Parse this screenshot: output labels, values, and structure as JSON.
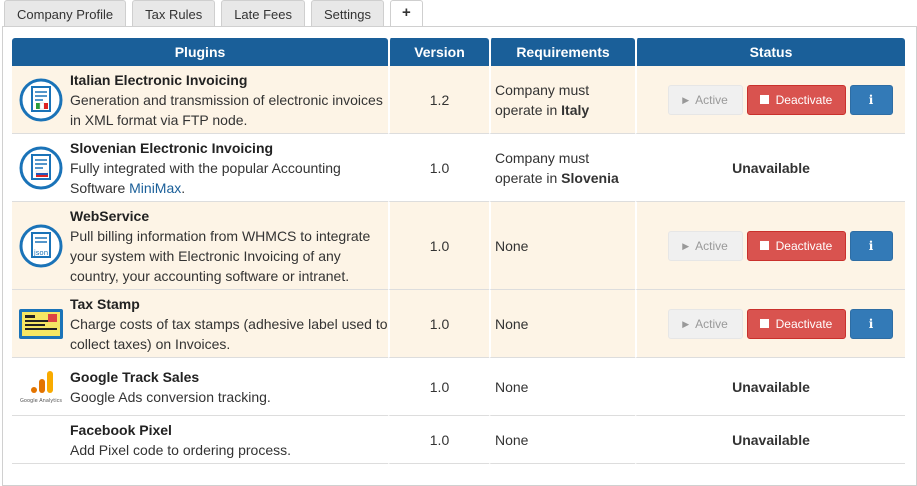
{
  "tabs": [
    {
      "label": "Company Profile"
    },
    {
      "label": "Tax Rules"
    },
    {
      "label": "Late Fees"
    },
    {
      "label": "Settings"
    },
    {
      "label": "+"
    }
  ],
  "table": {
    "headers": {
      "plugins": "Plugins",
      "version": "Version",
      "requirements": "Requirements",
      "status": "Status"
    },
    "buttons": {
      "active": "Active",
      "deactivate": "Deactivate",
      "info": "i"
    },
    "rows": [
      {
        "name": "Italian Electronic Invoicing",
        "desc": "Generation and transmission of electronic invoices in XML format via FTP node.",
        "version": "1.2",
        "req_prefix": "Company must operate in ",
        "req_bold": "Italy",
        "status": "controls",
        "icon": "italian-invoice-icon"
      },
      {
        "name": "Slovenian Electronic Invoicing",
        "desc": "Fully integrated with the popular Accounting Software ",
        "desc_link": "MiniMax",
        "desc_suffix": ".",
        "version": "1.0",
        "req_prefix": "Company must operate in ",
        "req_bold": "Slovenia",
        "status_text": "Unavailable",
        "icon": "slovenian-invoice-icon"
      },
      {
        "name": "WebService",
        "desc": "Pull billing information from WHMCS to integrate your system with Electronic Invoicing of any country, your accounting software or intranet.",
        "version": "1.0",
        "req": "None",
        "status": "controls",
        "icon": "json-document-icon",
        "icon_label": "json"
      },
      {
        "name": "Tax Stamp",
        "desc": "Charge costs of tax stamps (adhesive label used to collect taxes) on Invoices.",
        "version": "1.0",
        "req": "None",
        "status": "controls",
        "icon": "tax-stamp-icon"
      },
      {
        "name": "Google Track Sales",
        "desc": "Google Ads conversion tracking.",
        "version": "1.0",
        "req": "None",
        "status_text": "Unavailable",
        "icon": "google-analytics-icon",
        "icon_label": "Google Analytics"
      },
      {
        "name": "Facebook Pixel",
        "desc": "Add Pixel code to ordering process.",
        "version": "1.0",
        "req": "None",
        "status_text": "Unavailable"
      }
    ]
  },
  "colors": {
    "header": "#1a5f99",
    "highlight_row": "#fdf4e6",
    "deactivate": "#d9534f",
    "info": "#337ab7"
  }
}
